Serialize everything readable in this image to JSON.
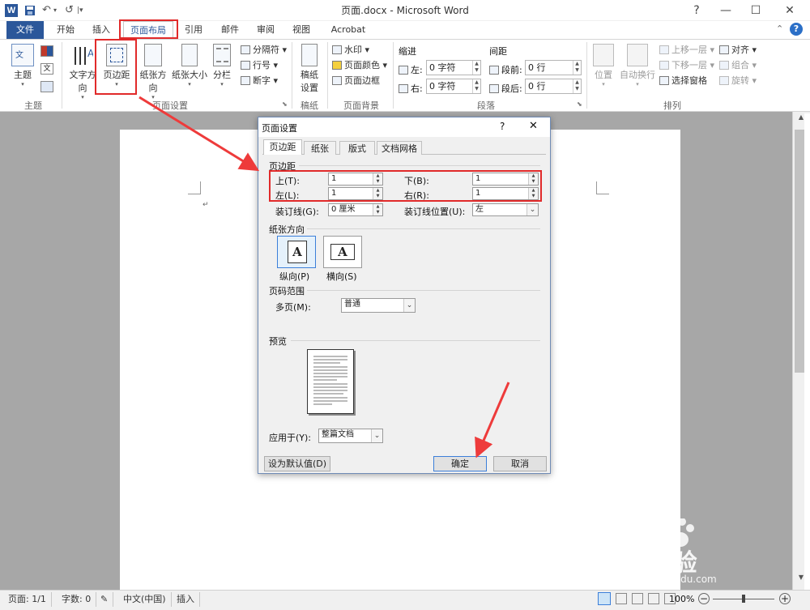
{
  "titlebar": {
    "app_icon": "W",
    "title": "页面.docx - Microsoft Word",
    "undo": "↶",
    "redo": "↺",
    "winbtns": [
      "?",
      "—",
      "☐",
      "✕"
    ]
  },
  "tabs": [
    "文件",
    "开始",
    "插入",
    "页面布局",
    "引用",
    "邮件",
    "审阅",
    "视图",
    "Acrobat"
  ],
  "ribbon": {
    "theme": {
      "theme_btn": "主题",
      "group": "主题"
    },
    "page_setup": {
      "text_dir": "文字方向",
      "margins": "页边距",
      "orientation": "纸张方向",
      "size": "纸张大小",
      "columns": "分栏",
      "breaks": "分隔符",
      "line_numbers": "行号",
      "hyphenation": "断字",
      "group": "页面设置"
    },
    "draft": {
      "btn1": "稿纸",
      "btn2": "设置",
      "group": "稿纸"
    },
    "background": {
      "watermark": "水印",
      "page_color": "页面颜色",
      "page_border": "页面边框",
      "group": "页面背景"
    },
    "paragraph": {
      "indent": "缩进",
      "spacing": "间距",
      "left_label": "左:",
      "left_val": "0 字符",
      "right_label": "右:",
      "right_val": "0 字符",
      "before_label": "段前:",
      "before_val": "0 行",
      "after_label": "段后:",
      "after_val": "0 行",
      "group": "段落"
    },
    "arrange": {
      "position": "位置",
      "wrap": "自动换行",
      "bring_forward": "上移一层",
      "send_backward": "下移一层",
      "selection_pane": "选择窗格",
      "align": "对齐",
      "group_btn": "组合",
      "rotate": "旋转",
      "group": "排列"
    }
  },
  "dialog": {
    "title": "页面设置",
    "help": "?",
    "close": "✕",
    "tabs": [
      "页边距",
      "纸张",
      "版式",
      "文档网格"
    ],
    "margins_section": "页边距",
    "top_label": "上(T):",
    "top_val": "1",
    "bottom_label": "下(B):",
    "bottom_val": "1",
    "left_label": "左(L):",
    "left_val": "1",
    "right_label": "右(R):",
    "right_val": "1",
    "gutter_label": "装订线(G):",
    "gutter_val": "0 厘米",
    "gutter_pos_label": "装订线位置(U):",
    "gutter_pos_val": "左",
    "orientation_section": "纸张方向",
    "portrait": "纵向(P)",
    "landscape": "横向(S)",
    "pages_section": "页码范围",
    "multi_label": "多页(M):",
    "multi_val": "普通",
    "preview_section": "预览",
    "apply_label": "应用于(Y):",
    "apply_val": "整篇文档",
    "default_btn": "设为默认值(D)",
    "ok_btn": "确定",
    "cancel_btn": "取消"
  },
  "statusbar": {
    "page": "页面: 1/1",
    "words": "字数: 0",
    "lang": "中文(中国)",
    "mode": "插入",
    "zoom": "100%"
  },
  "watermark": {
    "brand": "Bai经验",
    "url": "jingyan.baidu.com"
  },
  "colors": {
    "accent": "#2b579a",
    "highlight": "#e12a2a"
  }
}
